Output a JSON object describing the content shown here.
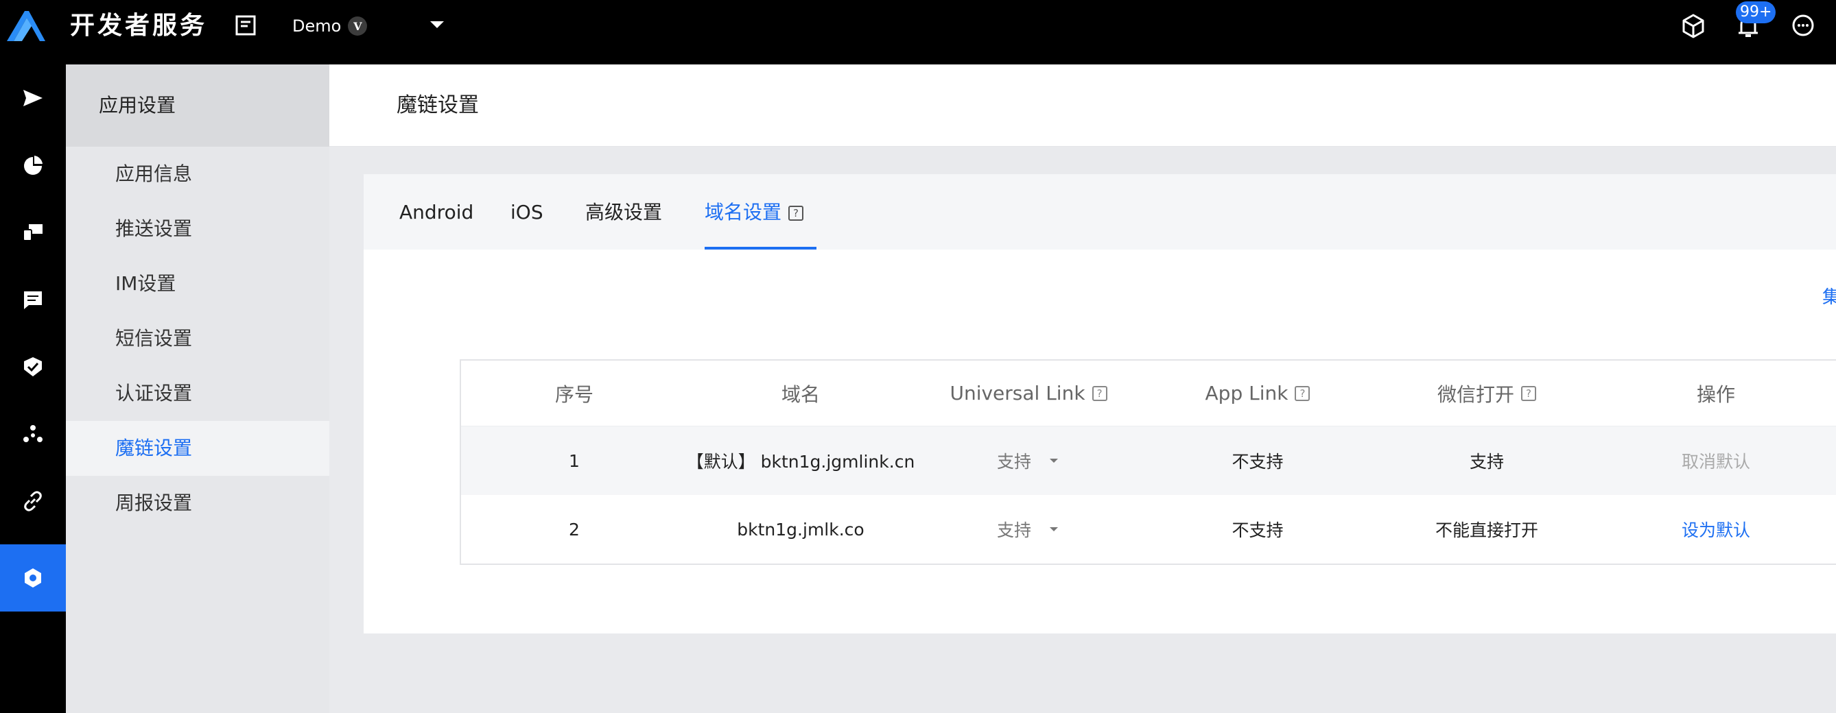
{
  "topbar": {
    "brand": "开发者服务",
    "app_name": "Demo",
    "app_badge": "V",
    "notification_count": "99+",
    "icons": [
      "logo-icon",
      "document-icon",
      "chevron-down-icon",
      "cube-icon",
      "bell-icon",
      "chat-icon"
    ]
  },
  "rail": {
    "items": [
      {
        "icon": "send-icon"
      },
      {
        "icon": "pie-chart-icon"
      },
      {
        "icon": "devices-icon"
      },
      {
        "icon": "message-icon"
      },
      {
        "icon": "shield-check-icon"
      },
      {
        "icon": "nodes-icon"
      },
      {
        "icon": "link-icon"
      },
      {
        "icon": "settings-icon",
        "active": true
      }
    ]
  },
  "menu": {
    "title": "应用设置",
    "items": [
      {
        "label": "应用信息"
      },
      {
        "label": "推送设置"
      },
      {
        "label": "IM设置"
      },
      {
        "label": "短信设置"
      },
      {
        "label": "认证设置"
      },
      {
        "label": "魔链设置",
        "active": true
      },
      {
        "label": "周报设置"
      }
    ]
  },
  "page": {
    "title": "魔链设置"
  },
  "tabs": [
    {
      "label": "Android"
    },
    {
      "label": "iOS"
    },
    {
      "label": "高级设置"
    },
    {
      "label": "域名设置",
      "active": true,
      "help": "?"
    }
  ],
  "edge_link": "集",
  "table": {
    "headers": {
      "index": "序号",
      "domain": "域名",
      "universal_link": "Universal Link",
      "app_link": "App Link",
      "wechat": "微信打开",
      "action": "操作"
    },
    "help_mark": "?",
    "rows": [
      {
        "index": "1",
        "domain": "【默认】 bktn1g.jgmlink.cn",
        "universal_link": "支持",
        "app_link": "不支持",
        "wechat": "支持",
        "action": "取消默认"
      },
      {
        "index": "2",
        "domain": "bktn1g.jmlk.co",
        "universal_link": "支持",
        "app_link": "不支持",
        "wechat": "不能直接打开",
        "action": "设为默认"
      }
    ]
  },
  "colors": {
    "accent": "#1d6ff2",
    "topbar_bg": "#000000",
    "menu_bg": "#e6e7ea"
  }
}
